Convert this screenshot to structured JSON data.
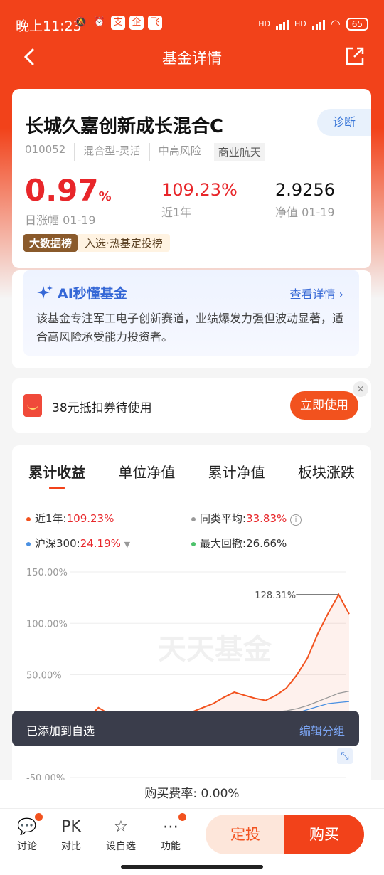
{
  "status_bar": {
    "time": "晚上11:23",
    "battery": "65",
    "signal_labels": [
      "HD",
      "HD"
    ],
    "app_icons": [
      "支",
      "企",
      "飞"
    ]
  },
  "header": {
    "title": "基金详情"
  },
  "fund": {
    "name": "长城久嘉创新成长混合C",
    "diagnose_label": "诊断",
    "code": "010052",
    "type": "混合型-灵活",
    "risk": "中高风险",
    "sector": "商业航天",
    "daily_change": "0.97",
    "daily_change_unit": "%",
    "daily_change_label": "日涨幅 01-19",
    "one_year": "109.23%",
    "one_year_label": "近1年",
    "nav": "2.9256",
    "nav_label": "净值 01-19",
    "bigdata_badge": "大数据榜",
    "bigdata_text": "入选·热基定投榜"
  },
  "ai": {
    "title": "AI秒懂基金",
    "more": "查看详情",
    "body": "该基金专注军工电子创新赛道，业绩爆发力强但波动显著，适合高风险承受能力投资者。"
  },
  "coupon": {
    "text": "38元抵扣券待使用",
    "button": "立即使用",
    "close": "×"
  },
  "chart_tabs": [
    "累计收益",
    "单位净值",
    "累计净值",
    "板块涨跌"
  ],
  "legend": {
    "fund_label": "近1年:",
    "fund_value": "109.23%",
    "peer_label": "同类平均:",
    "peer_value": "33.83%",
    "index_label": "沪深300:",
    "index_value": "24.19%",
    "drawdown_label": "最大回撤:",
    "drawdown_value": "26.66%"
  },
  "colors": {
    "fund": "#f2521e",
    "peer": "#999999",
    "index": "#4a90e2",
    "drawdown": "#4cc26b",
    "brand": "#f2421a"
  },
  "chart_data": {
    "type": "line",
    "ylim": [
      -50,
      150
    ],
    "yticks": [
      "150.00%",
      "100.00%",
      "50.00%",
      "-50.00%"
    ],
    "annotation": "128.31%",
    "watermark": "天天基金",
    "series": [
      {
        "name": "近1年",
        "values": [
          0,
          8,
          18,
          12,
          5,
          3,
          2,
          0,
          2,
          5,
          10,
          14,
          18,
          22,
          28,
          33,
          30,
          27,
          25,
          30,
          37,
          50,
          66,
          90,
          110,
          128,
          109
        ]
      },
      {
        "name": "同类平均",
        "values": [
          0,
          4,
          6,
          3,
          1,
          0,
          -1,
          -2,
          0,
          2,
          4,
          5,
          7,
          9,
          11,
          13,
          12,
          12,
          13,
          14,
          15,
          17,
          20,
          24,
          28,
          32,
          34
        ]
      },
      {
        "name": "沪深300",
        "values": [
          0,
          3,
          4,
          1,
          0,
          -1,
          -2,
          -2,
          -1,
          1,
          2,
          3,
          4,
          6,
          8,
          9,
          9,
          10,
          10,
          11,
          12,
          13,
          16,
          19,
          22,
          23,
          24
        ]
      }
    ]
  },
  "toast": {
    "text": "已添加到自选",
    "action": "编辑分组"
  },
  "fee": "购买费率: 0.00%",
  "bottom_nav": {
    "items": [
      {
        "icon": "💬",
        "label": "讨论"
      },
      {
        "icon": "PK",
        "label": "对比"
      },
      {
        "icon": "☆",
        "label": "设自选"
      },
      {
        "icon": "⋯",
        "label": "功能"
      }
    ],
    "dingtou": "定投",
    "buy": "购买"
  }
}
